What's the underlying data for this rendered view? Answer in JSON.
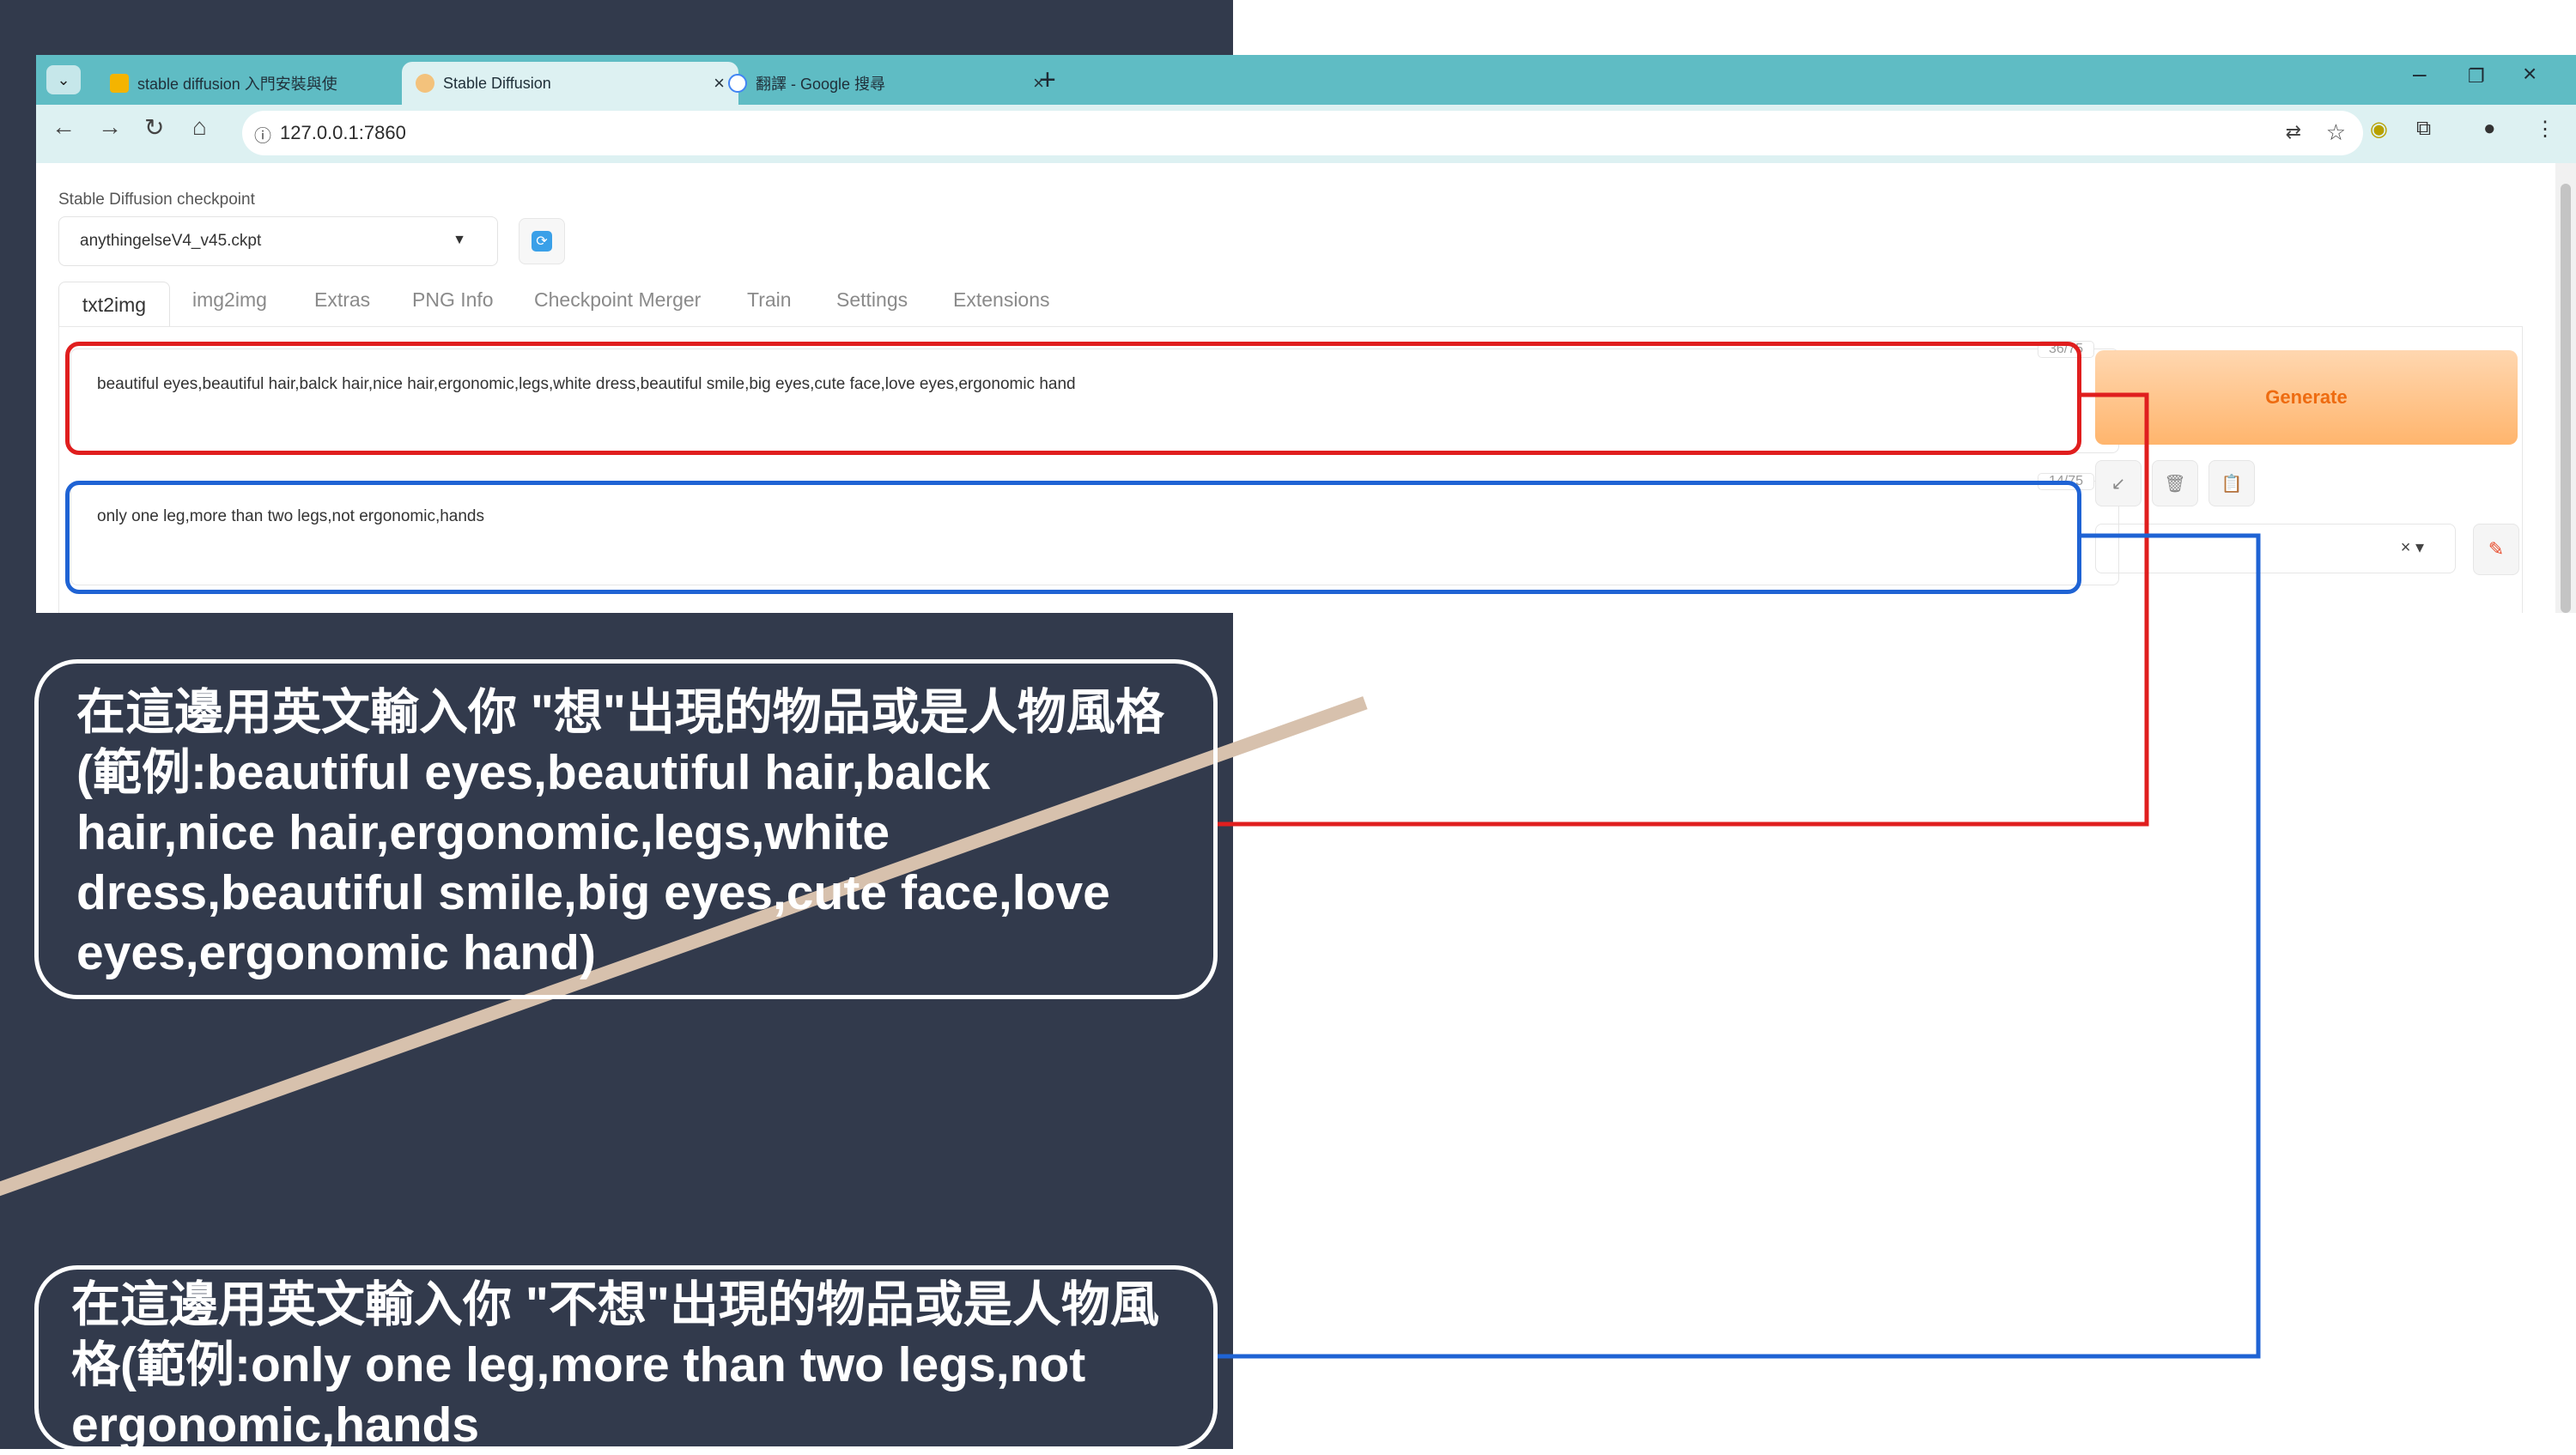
{
  "browser": {
    "tabs": [
      {
        "title": "stable diffusion 入門安裝與使",
        "active": false
      },
      {
        "title": "Stable Diffusion",
        "active": true
      },
      {
        "title": "翻譯 - Google 搜尋",
        "active": false
      }
    ],
    "url": "127.0.0.1:7860"
  },
  "webui": {
    "checkpoint_label": "Stable Diffusion checkpoint",
    "checkpoint_value": "anythingelseV4_v45.ckpt",
    "tabs": [
      "txt2img",
      "img2img",
      "Extras",
      "PNG Info",
      "Checkpoint Merger",
      "Train",
      "Settings",
      "Extensions"
    ],
    "prompt": "beautiful eyes,beautiful hair,balck hair,nice hair,ergonomic,legs,white dress,beautiful smile,big eyes,cute face,love eyes,ergonomic hand",
    "prompt_counter": "36/75",
    "negative_prompt": "only one leg,more than two legs,not ergonomic,hands",
    "negative_counter": "14/75",
    "generate_label": "Generate"
  },
  "annotations": {
    "positive": "在這邊用英文輸入你 \"想\"出現的物品或是人物風格(範例:beautiful eyes,beautiful hair,balck hair,nice hair,ergonomic,legs,white dress,beautiful smile,big eyes,cute face,love eyes,ergonomic hand)",
    "negative": "在這邊用英文輸入你 \"不想\"出現的物品或是人物風格(範例:only one leg,more than two legs,not ergonomic,hands"
  },
  "colors": {
    "slide_bg": "#323a4c",
    "accent_stripe": "#d7c1ad",
    "highlight_positive": "#e01e1e",
    "highlight_negative": "#1f63d4",
    "browser_chrome": "#5fbcc4",
    "generate_text": "#ee6b10"
  }
}
